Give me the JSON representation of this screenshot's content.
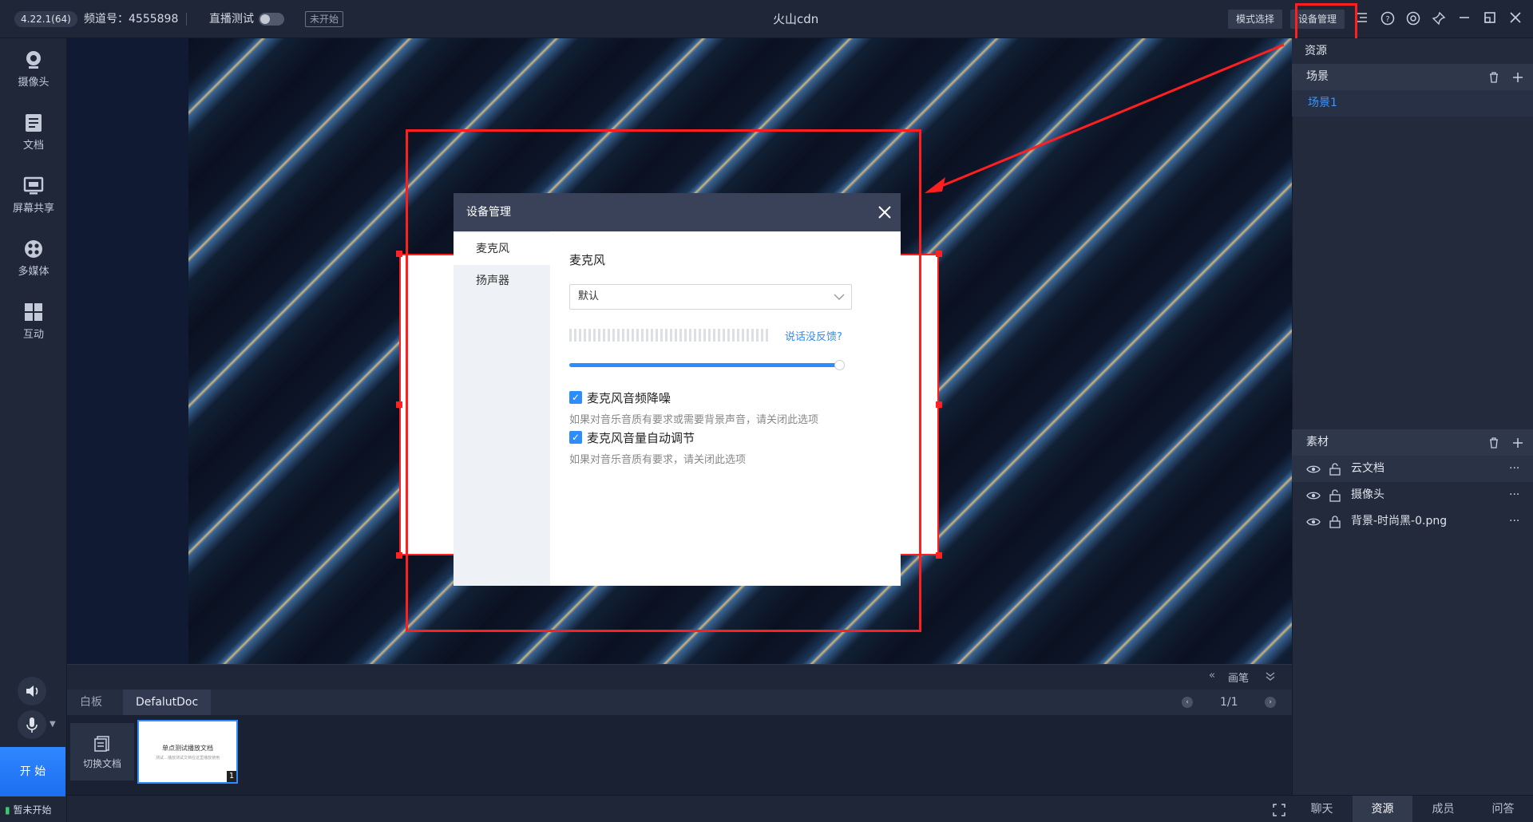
{
  "topbar": {
    "version": "4.22.1(64)",
    "channel_label": "频道号：4555898",
    "live_test_label": "直播测试",
    "status": "未开始",
    "title": "火山cdn",
    "mode_select": "模式选择",
    "device_manage": "设备管理"
  },
  "sidebar": {
    "items": [
      {
        "label": "摄像头"
      },
      {
        "label": "文档"
      },
      {
        "label": "屏幕共享"
      },
      {
        "label": "多媒体"
      },
      {
        "label": "互动"
      }
    ],
    "start": "开 始",
    "live_status": "暂未开始"
  },
  "bottom": {
    "pen_label": "画笔",
    "tabs": [
      "白板",
      "DefalutDoc"
    ],
    "page": "1/1",
    "switch_doc": "切换文档",
    "thumb_title": "单点测试播放文档",
    "thumb_sub": "测试…播放测试文档在这里播放使用",
    "thumb_index": "1"
  },
  "right": {
    "resources_title": "资源",
    "scene_section": "场景",
    "scene_item": "场景1",
    "material_section": "素材",
    "materials": [
      {
        "name": "云文档"
      },
      {
        "name": "摄像头"
      },
      {
        "name": "背景-时尚黑-0.png"
      }
    ],
    "tabs": [
      "聊天",
      "资源",
      "成员",
      "问答"
    ]
  },
  "dialog": {
    "title": "设备管理",
    "nav": [
      "麦克风",
      "扬声器"
    ],
    "section_title": "麦克风",
    "select_value": "默认",
    "no_feedback": "说话没反馈?",
    "volume": 0.98,
    "options": [
      {
        "label": "麦克风音频降噪",
        "desc": "如果对音乐音质有要求或需要背景声音，请关闭此选项"
      },
      {
        "label": "麦克风音量自动调节",
        "desc": "如果对音乐音质有要求，请关闭此选项"
      }
    ]
  },
  "colors": {
    "accent": "#2d8cff",
    "annotation": "#ff1f1f"
  }
}
